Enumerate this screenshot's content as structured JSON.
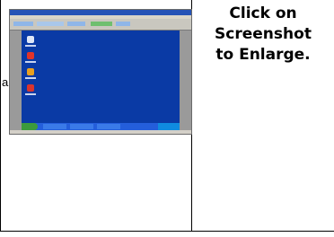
{
  "caption": {
    "line1": "Click on",
    "line2": "Screenshot",
    "line3": "to Enlarge."
  },
  "cut_text": "a",
  "thumbnail": {
    "icon": "screenshot-thumbnail-icon"
  },
  "colors": {
    "desktop": "#0a3aa5",
    "taskbar": "#245edb",
    "titlebar": "#2553b6"
  }
}
